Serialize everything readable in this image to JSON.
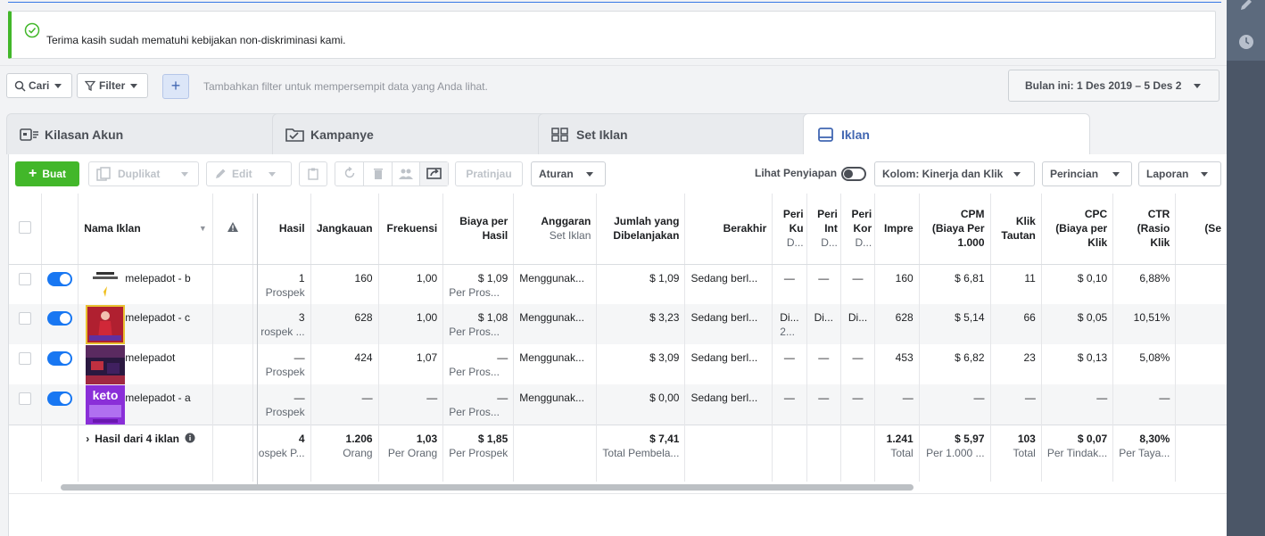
{
  "notice": {
    "message": "Terima kasih sudah mematuhi kebijakan non-diskriminasi kami."
  },
  "filterbar": {
    "search_label": "Cari",
    "filter_label": "Filter",
    "add_label": "+",
    "hint": "Tambahkan filter untuk mempersempit data yang Anda lihat.",
    "date_range": "Bulan ini: 1 Des 2019 – 5 Des 2"
  },
  "tabs": [
    {
      "label": "Kilasan Akun"
    },
    {
      "label": "Kampanye"
    },
    {
      "label": "Set Iklan"
    },
    {
      "label": "Iklan"
    }
  ],
  "toolbar": {
    "create": "Buat",
    "duplicate": "Duplikat",
    "edit": "Edit",
    "preview": "Pratinjau",
    "rules": "Aturan",
    "view_setup": "Lihat Penyiapan",
    "columns": "Kolom: Kinerja dan Klik",
    "breakdown": "Perincian",
    "reports": "Laporan"
  },
  "columns": {
    "name": "Nama Iklan",
    "result": "Hasil",
    "reach": "Jangkauan",
    "frequency": "Frekuensi",
    "cost_per_result_1": "Biaya per",
    "cost_per_result_2": "Hasil",
    "budget_1": "Anggaran",
    "budget_2": "Set Iklan",
    "spent_1": "Jumlah yang",
    "spent_2": "Dibelanjakan",
    "ends": "Berakhir",
    "p1_1": "Peri",
    "p1_2": "Ku",
    "p1_3": "D...",
    "p2_1": "Peri",
    "p2_2": "Int",
    "p2_3": "D...",
    "p3_1": "Peri",
    "p3_2": "Kor",
    "p3_3": "D...",
    "impressions": "Impre",
    "cpm_1": "CPM",
    "cpm_2": "(Biaya Per",
    "cpm_3": "1.000",
    "link_1": "Klik",
    "link_2": "Tautan",
    "cpc_1": "CPC",
    "cpc_2": "(Biaya per",
    "cpc_3": "Klik",
    "ctr_1": "CTR",
    "ctr_2": "(Rasio",
    "ctr_3": "Klik",
    "extra": "(Se"
  },
  "rows": [
    {
      "name": "melepadot - b",
      "result": "1",
      "result_sub": "Prospek",
      "reach": "160",
      "freq": "1,00",
      "cpr": "$ 1,09",
      "cpr_sub": "Per Pros...",
      "budget": "Menggunak...",
      "spent": "$ 1,09",
      "ends": "Sedang berl...",
      "p1": "—",
      "p1_sub": "",
      "p2": "—",
      "p3": "—",
      "impr": "160",
      "cpm": "$ 6,81",
      "link": "11",
      "cpc": "$ 0,10",
      "ctr": "6,88%"
    },
    {
      "name": "melepadot - c",
      "result": "3",
      "result_sub": "rospek ...",
      "reach": "628",
      "freq": "1,00",
      "cpr": "$ 1,08",
      "cpr_sub": "Per Pros...",
      "budget": "Menggunak...",
      "spent": "$ 3,23",
      "ends": "Sedang berl...",
      "p1": "Di...",
      "p1_sub": "2...",
      "p2": "Di...",
      "p3": "Di...",
      "impr": "628",
      "cpm": "$ 5,14",
      "link": "66",
      "cpc": "$ 0,05",
      "ctr": "10,51%"
    },
    {
      "name": "melepadot",
      "result": "—",
      "result_sub": "Prospek",
      "reach": "424",
      "freq": "1,07",
      "cpr": "—",
      "cpr_sub": "Per Pros...",
      "budget": "Menggunak...",
      "spent": "$ 3,09",
      "ends": "Sedang berl...",
      "p1": "—",
      "p1_sub": "",
      "p2": "—",
      "p3": "—",
      "impr": "453",
      "cpm": "$ 6,82",
      "link": "23",
      "cpc": "$ 0,13",
      "ctr": "5,08%"
    },
    {
      "name": "melepadot - a",
      "result": "—",
      "result_sub": "Prospek",
      "reach": "—",
      "freq": "—",
      "cpr": "—",
      "cpr_sub": "Per Pros...",
      "budget": "Menggunak...",
      "spent": "$ 0,00",
      "ends": "Sedang berl...",
      "p1": "—",
      "p1_sub": "",
      "p2": "—",
      "p3": "—",
      "impr": "—",
      "cpm": "—",
      "link": "—",
      "cpc": "—",
      "ctr": "—"
    }
  ],
  "total": {
    "label": "Hasil dari 4 iklan",
    "result": "4",
    "result_sub": "ospek P...",
    "reach": "1.206",
    "reach_sub": "Orang",
    "freq": "1,03",
    "freq_sub": "Per Orang",
    "cpr": "$ 1,85",
    "cpr_sub": "Per Prospek",
    "spent": "$ 7,41",
    "spent_sub": "Total Pembela...",
    "impr": "1.241",
    "impr_sub": "Total",
    "cpm": "$ 5,97",
    "cpm_sub": "Per 1.000 ...",
    "link": "103",
    "link_sub": "Total",
    "cpc": "$ 0,07",
    "cpc_sub": "Per Tindak...",
    "ctr": "8,30%",
    "ctr_sub": "Per Taya..."
  },
  "thumb_text": {
    "keto": "keto"
  },
  "colors": {
    "accent": "#4267b2",
    "create_green": "#42b72a",
    "toggle_blue": "#1877f2"
  }
}
